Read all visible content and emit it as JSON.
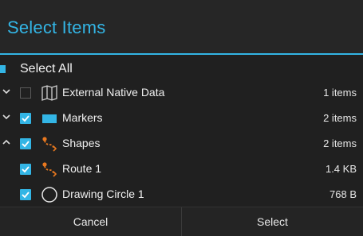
{
  "dialog": {
    "title": "Select Items",
    "accent_color": "#33b5e5"
  },
  "select_all": {
    "label": "Select All",
    "checked": "partial"
  },
  "items": [
    {
      "label": "External Native Data",
      "size": "1 items",
      "checked": false,
      "expand": "collapsed",
      "icon": "map-icon"
    },
    {
      "label": "Markers",
      "size": "2 items",
      "checked": true,
      "expand": "collapsed",
      "icon": "marker-rect-icon"
    },
    {
      "label": "Shapes",
      "size": "2 items",
      "checked": true,
      "expand": "expanded",
      "icon": "route-icon"
    },
    {
      "label": "Route 1",
      "size": "1.4 KB",
      "checked": true,
      "expand": "none",
      "icon": "route-icon"
    },
    {
      "label": "Drawing Circle 1",
      "size": "768 B",
      "checked": true,
      "expand": "none",
      "icon": "circle-icon"
    }
  ],
  "buttons": {
    "cancel": "Cancel",
    "select": "Select"
  }
}
